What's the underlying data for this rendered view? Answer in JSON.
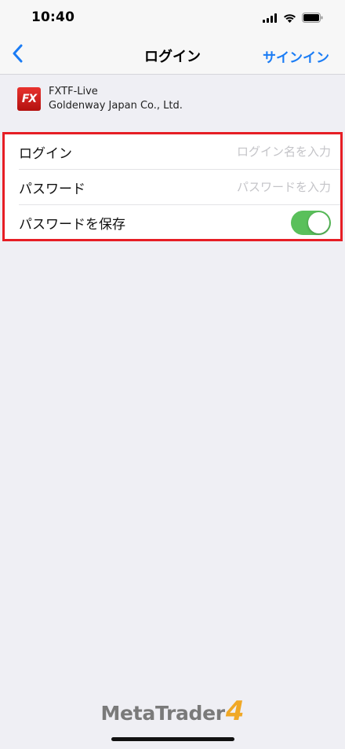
{
  "status_bar": {
    "time": "10:40",
    "icons": [
      "signal-icon",
      "wifi-icon",
      "battery-icon"
    ]
  },
  "nav": {
    "back_icon": "chevron-left-icon",
    "title": "ログイン",
    "action_label": "サインイン"
  },
  "server": {
    "logo_text": "FX",
    "name": "FXTF-Live",
    "company": "Goldenway Japan Co., Ltd."
  },
  "form": {
    "login": {
      "label": "ログイン",
      "value": "",
      "placeholder": "ログイン名を入力"
    },
    "password": {
      "label": "パスワード",
      "value": "",
      "placeholder": "パスワードを入力"
    },
    "save_password": {
      "label": "パスワードを保存",
      "enabled": true
    }
  },
  "brand": {
    "name": "MetaTrader",
    "number": "4"
  },
  "colors": {
    "accent": "#1a7cf5",
    "highlight_border": "#e61e25",
    "toggle_on": "#5ac05b",
    "brand_number": "#f0a826"
  }
}
